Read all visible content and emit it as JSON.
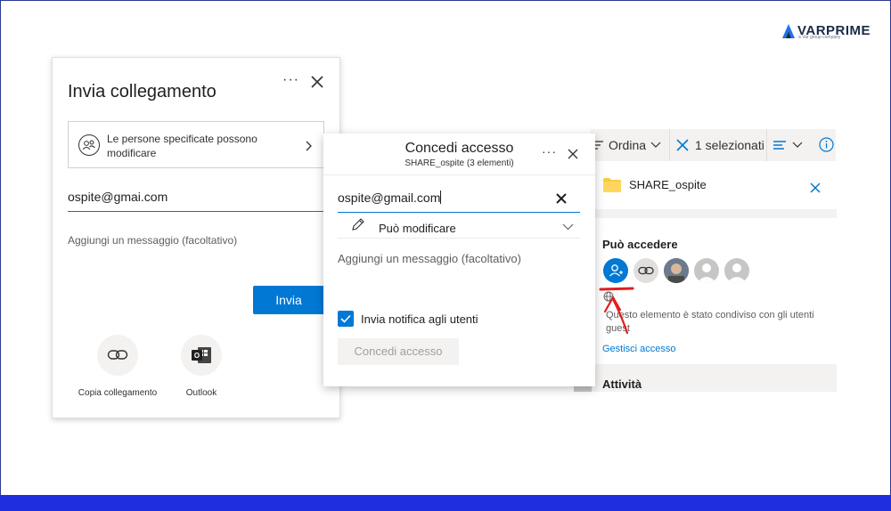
{
  "logo": {
    "name": "VARPRIME",
    "tagline": "a Var group company"
  },
  "send_link_panel": {
    "title": "Invia collegamento",
    "more_label": "···",
    "permission_text": "Le persone specificate possono modificare",
    "email_value": "ospite@gmai.com",
    "message_placeholder": "Aggiungi un messaggio (facoltativo)",
    "send_button": "Invia",
    "share_options": [
      {
        "label": "Copia collegamento",
        "icon": "link-icon"
      },
      {
        "label": "Outlook",
        "icon": "outlook-icon"
      }
    ]
  },
  "grant_access_panel": {
    "title": "Concedi accesso",
    "subtitle": "SHARE_ospite (3 elementi)",
    "more_label": "···",
    "email_value": "ospite@gmail.com",
    "permission_label": "Può modificare",
    "message_placeholder": "Aggiungi un messaggio (facoltativo)",
    "notify_label": "Invia notifica agli utenti",
    "notify_checked": true,
    "grant_button": "Concedi accesso"
  },
  "details_panel": {
    "toolbar": {
      "sort_label": "Ordina",
      "selected_label": "1 selezionati"
    },
    "folder_name": "SHARE_ospite",
    "access_title": "Può accedere",
    "description": "Questo elemento è stato condiviso con gli utenti guest",
    "manage_link": "Gestisci accesso",
    "activity_title": "Attività"
  },
  "colors": {
    "accent": "#0078d4",
    "annotation": "#e11d1d",
    "bottom_bar": "#1f2fe0"
  }
}
